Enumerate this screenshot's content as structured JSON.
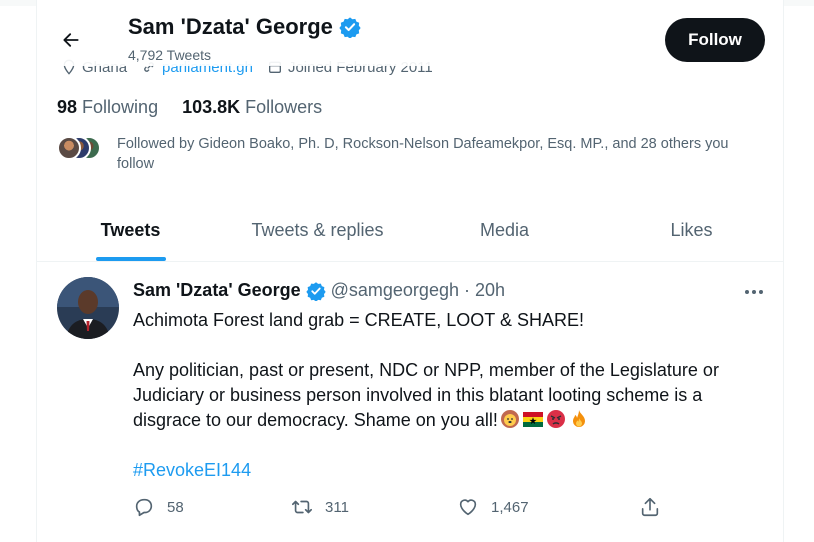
{
  "profile": {
    "name": "Sam 'Dzata' George",
    "tweet_count": "4,792 Tweets",
    "location": "Ghana",
    "website": "parliament.gh",
    "joined": "Joined February 2011",
    "follow_label": "Follow",
    "following_count": "98",
    "following_label": "Following",
    "followers_count": "103.8K",
    "followers_label": "Followers",
    "followed_by_text": "Followed by Gideon Boako, Ph. D, Rockson-Nelson Dafeamekpor, Esq. MP., and 28 others you follow"
  },
  "tabs": [
    {
      "label": "Tweets",
      "active": true
    },
    {
      "label": "Tweets & replies",
      "active": false
    },
    {
      "label": "Media",
      "active": false
    },
    {
      "label": "Likes",
      "active": false
    }
  ],
  "tweet": {
    "name": "Sam 'Dzata' George",
    "handle": "@samgeorgegh",
    "separator": "·",
    "time": "20h",
    "line1": "Achimota Forest land grab = CREATE, LOOT & SHARE!",
    "line2": "Any politician, past or present, NDC or NPP, member of the Legislature or Judiciary or business person involved in this blatant looting scheme is a disgrace to our democracy. Shame on you all!",
    "emojis": [
      "lion-emoji",
      "ghana-flag-emoji",
      "angry-face-emoji",
      "fire-emoji"
    ],
    "hashtag": "#RevokeEI144",
    "replies": "58",
    "retweets": "311",
    "likes": "1,467"
  },
  "colors": {
    "accent": "#1d9bf0",
    "text_primary": "#0f1419",
    "text_secondary": "#536471",
    "follow_button": "#0f1419"
  }
}
